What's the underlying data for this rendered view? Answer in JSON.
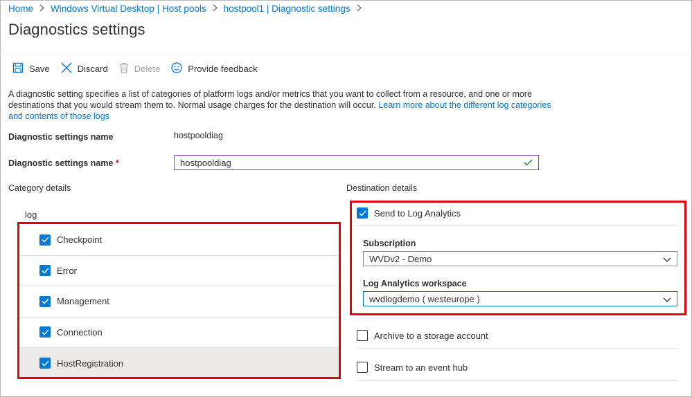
{
  "breadcrumb": {
    "items": [
      "Home",
      "Windows Virtual Desktop | Host pools",
      "hostpool1 | Diagnostic settings"
    ]
  },
  "page": {
    "title": "Diagnostics settings"
  },
  "toolbar": {
    "save": "Save",
    "discard": "Discard",
    "delete": "Delete",
    "feedback": "Provide feedback"
  },
  "description": {
    "text": "A diagnostic setting specifies a list of categories of platform logs and/or metrics that you want to collect from a resource, and one or more destinations that you would stream them to. Normal usage charges for the destination will occur. ",
    "link": "Learn more about the different log categories and contents of those logs"
  },
  "form": {
    "name_label_static": "Diagnostic settings name",
    "name_value_static": "hostpooldiag",
    "name_label_input": "Diagnostic settings name",
    "required_mark": "*",
    "name_input_value": "hostpooldiag"
  },
  "category": {
    "heading": "Category details",
    "group_label": "log",
    "items": [
      {
        "label": "Checkpoint",
        "checked": true
      },
      {
        "label": "Error",
        "checked": true
      },
      {
        "label": "Management",
        "checked": true
      },
      {
        "label": "Connection",
        "checked": true
      },
      {
        "label": "HostRegistration",
        "checked": true
      }
    ]
  },
  "destination": {
    "heading": "Destination details",
    "log_analytics": {
      "label": "Send to Log Analytics",
      "checked": true
    },
    "subscription": {
      "label": "Subscription",
      "value": "WVDv2 - Demo"
    },
    "workspace": {
      "label": "Log Analytics workspace",
      "value": "wvdlogdemo ( westeurope )"
    },
    "storage": {
      "label": "Archive to a storage account",
      "checked": false
    },
    "event_hub": {
      "label": "Stream to an event hub",
      "checked": false
    }
  },
  "colors": {
    "accent": "#0078d4",
    "highlight": "#e3000f",
    "input_focus": "#8a3bd1",
    "valid": "#107c10"
  }
}
